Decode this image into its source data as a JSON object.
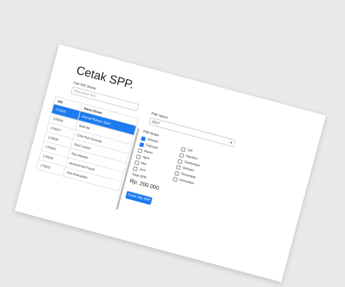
{
  "page": {
    "title": "Cetak SPP."
  },
  "search": {
    "label": "Cari NIS Siswa",
    "placeholder": "Masukkan NIS"
  },
  "table": {
    "headers": [
      "NIS",
      "Nama Siswa"
    ],
    "rows": [
      {
        "nis": "170025",
        "nama": "Ahmad Ridwan Syah",
        "selected": true
      },
      {
        "nis": "170026",
        "nama": "Budi Aji",
        "selected": false
      },
      {
        "nis": "170027",
        "nama": "Citra Putri Kumala",
        "selected": false
      },
      {
        "nis": "170028",
        "nama": "Desi Lestari",
        "selected": false
      },
      {
        "nis": "170029",
        "nama": "Eko Adriatis",
        "selected": false
      },
      {
        "nis": "170030",
        "nama": "Muhammad Faisal",
        "selected": false
      },
      {
        "nis": "170031",
        "nama": "Gita Ramadani",
        "selected": false
      }
    ]
  },
  "tahun": {
    "label": "Pilih Tahun",
    "value": "2017"
  },
  "bulan": {
    "label": "Pilih Bulan",
    "col1": [
      {
        "name": "Januari",
        "checked": true
      },
      {
        "name": "Februari",
        "checked": true
      },
      {
        "name": "Maret",
        "checked": false
      },
      {
        "name": "April",
        "checked": false
      },
      {
        "name": "Mei",
        "checked": false
      },
      {
        "name": "Juni",
        "checked": false
      }
    ],
    "col2": [
      {
        "name": "Juli",
        "checked": false
      },
      {
        "name": "Agustus",
        "checked": false
      },
      {
        "name": "September",
        "checked": false
      },
      {
        "name": "Oktober",
        "checked": false
      },
      {
        "name": "November",
        "checked": false
      },
      {
        "name": "Desember",
        "checked": false
      }
    ]
  },
  "total": {
    "label": "Total SPP:",
    "value": "Rp. 200.000"
  },
  "actions": {
    "print_label": "Cetak Slip SPP"
  },
  "colors": {
    "accent": "#1e7bf0"
  }
}
